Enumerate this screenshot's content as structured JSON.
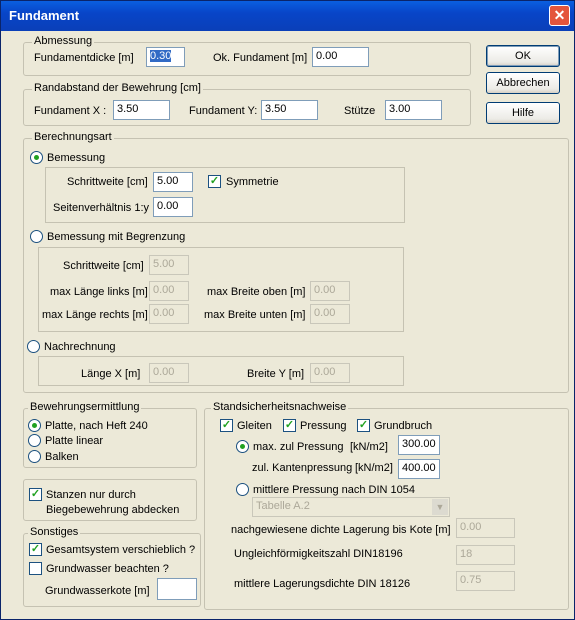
{
  "window": {
    "title": "Fundament",
    "close_icon": "close-icon"
  },
  "buttons": {
    "ok": "OK",
    "abbrechen": "Abbrechen",
    "hilfe": "Hilfe"
  },
  "abmessung": {
    "legend": "Abmessung",
    "fundamentdicke_label": "Fundamentdicke [m]",
    "fundamentdicke_value": "0.30",
    "ok_fundament_label": "Ok. Fundament [m]",
    "ok_fundament_value": "0.00"
  },
  "randabstand": {
    "legend": "Randabstand der Bewehrung [cm]",
    "fx_label": "Fundament X :",
    "fx_value": "3.50",
    "fy_label": "Fundament Y:",
    "fy_value": "3.50",
    "stuetze_label": "Stütze",
    "stuetze_value": "3.00"
  },
  "berechnungsart": {
    "legend": "Berechnungsart",
    "bemessung": {
      "label": "Bemessung",
      "selected": true,
      "schrittweite_label": "Schrittweite [cm]",
      "schrittweite_value": "5.00",
      "symmetrie_label": "Symmetrie",
      "symmetrie_checked": true,
      "seitenverhaeltnis_label": "Seitenverhältnis 1:y",
      "seitenverhaeltnis_value": "0.00"
    },
    "bemessung_begrenzung": {
      "label": "Bemessung mit Begrenzung",
      "selected": false,
      "schrittweite_label": "Schrittweite [cm]",
      "schrittweite_value": "5.00",
      "max_laenge_links_label": "max Länge links [m]",
      "max_laenge_links_value": "0.00",
      "max_breite_oben_label": "max Breite oben [m]",
      "max_breite_oben_value": "0.00",
      "max_laenge_rechts_label": "max Länge rechts [m]",
      "max_laenge_rechts_value": "0.00",
      "max_breite_unten_label": "max Breite unten [m]",
      "max_breite_unten_value": "0.00"
    },
    "nachrechnung": {
      "label": "Nachrechnung",
      "selected": false,
      "laenge_x_label": "Länge X [m]",
      "laenge_x_value": "0.00",
      "breite_y_label": "Breite Y [m]",
      "breite_y_value": "0.00"
    }
  },
  "bewehrungsermittlung": {
    "legend": "Bewehrungsermittlung",
    "options": [
      "Platte, nach Heft 240",
      "Platte linear",
      "Balken"
    ],
    "selected_index": 0
  },
  "stanzen": {
    "label_line1": "Stanzen nur durch",
    "label_line2": "Biegebewehrung abdecken",
    "checked": true
  },
  "sonstiges": {
    "legend": "Sonstiges",
    "gesamtsystem_label": "Gesamtsystem verschieblich ?",
    "gesamtsystem_checked": true,
    "grundwasser_label": "Grundwasser beachten ?",
    "grundwasser_checked": false,
    "grundwasserkote_label": "Grundwasserkote [m]",
    "grundwasserkote_value": ""
  },
  "standsicherheit": {
    "legend": "Standsicherheitsnachweise",
    "gleiten_label": "Gleiten",
    "gleiten_checked": true,
    "pressung_label": "Pressung",
    "pressung_checked": true,
    "grundbruch_label": "Grundbruch",
    "grundbruch_checked": true,
    "max_zul_pressung_label": "max. zul Pressung",
    "max_zul_pressung_unit": "[kN/m2]",
    "max_zul_pressung_value": "300.00",
    "max_zul_selected": true,
    "zul_kantenpressung_label": "zul. Kantenpressung",
    "zul_kantenpressung_unit": "[kN/m2]",
    "zul_kantenpressung_value": "400.00",
    "mittlere_pressung_label": "mittlere Pressung nach DIN 1054",
    "mittlere_selected": false,
    "tabelle_value": "Tabelle A.2",
    "lagerung_label": "nachgewiesene dichte Lagerung bis Kote [m]",
    "lagerung_value": "0.00",
    "ungleich_label": "Ungleichförmigkeitszahl DIN18196",
    "ungleich_value": "18",
    "lagerungsdichte_label": "mittlere Lagerungsdichte DIN 18126",
    "lagerungsdichte_value": "0.75"
  }
}
